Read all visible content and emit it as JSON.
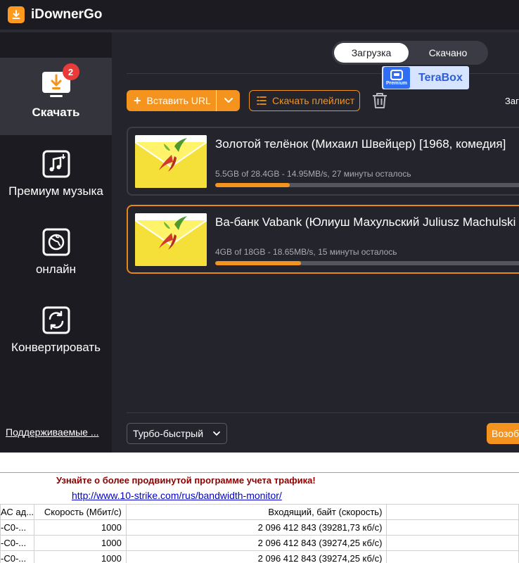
{
  "app": {
    "title": "iDownerGo"
  },
  "sidebar": {
    "items": [
      {
        "label": "Скачать",
        "icon": "download-monitor-icon",
        "badge": "2",
        "active": true
      },
      {
        "label": "Премиум музыка",
        "icon": "music-file-icon"
      },
      {
        "label": "онлайн",
        "icon": "globe-icon"
      },
      {
        "label": "Конвертировать",
        "icon": "convert-icon"
      }
    ],
    "supported_link": "Поддерживаемые ..."
  },
  "tabs": {
    "downloading": "Загрузка",
    "downloaded": "Скачано"
  },
  "terabox": {
    "premium": "Premium",
    "name": "TeraBox"
  },
  "toolbar": {
    "paste_url": "Вставить URL",
    "playlist": "Скачать плейлист",
    "cut_text": "Заг"
  },
  "downloads": [
    {
      "title": "Золотой телёнок (Михаил Швейцер) [1968, комедия]",
      "stats": "5.5GB of 28.4GB -   14.95MB/s, 27 минуты осталось",
      "progress": 0.22
    },
    {
      "title": "Ва-банк Vabank (Юлиуш Махульский Juliusz Machulski",
      "stats": "4GB of 18GB -   18.65MB/s, 15 минуты осталось",
      "progress": 0.255
    }
  ],
  "footer": {
    "speed_mode": "Турбо-быстрый",
    "resume": "Возоб"
  },
  "colors": {
    "accent": "#f5931f",
    "badge": "#ea3b3b",
    "sidebar_bg": "#1b1b21",
    "main_bg": "#24242c"
  },
  "monitor": {
    "promo": "Узнайте о более продвинутой программе учета трафика!",
    "link": "http://www.10-strike.com/rus/bandwidth-monitor/",
    "columns": [
      "АС ад...",
      "Скорость (Мбит/с)",
      "Входящий, байт (скорость)"
    ],
    "rows": [
      {
        "mac": "-C0-...",
        "speed": "1000",
        "incoming": "2 096 412 843    (39281,73 кб/с)"
      },
      {
        "mac": "-C0-...",
        "speed": "1000",
        "incoming": "2 096 412 843    (39274,25 кб/с)"
      },
      {
        "mac": "-C0-...",
        "speed": "1000",
        "incoming": "2 096 412 843    (39274,25 кб/с)"
      }
    ]
  }
}
